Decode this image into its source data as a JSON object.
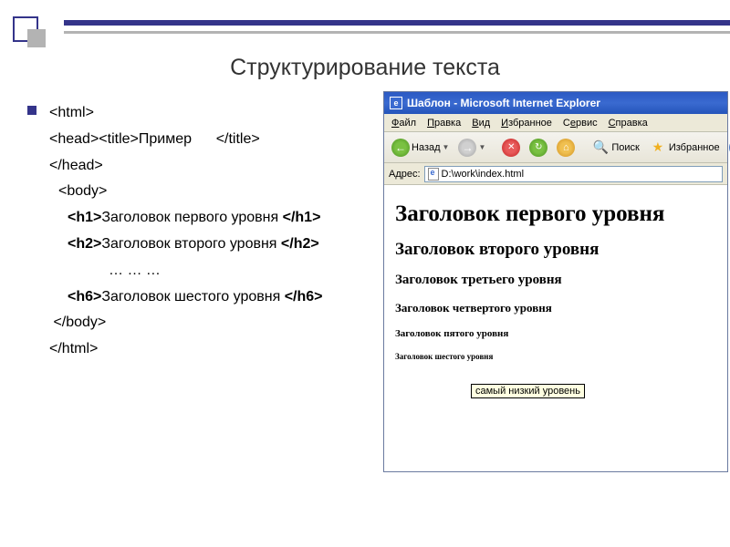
{
  "slide_title": "Структурирование текста",
  "code": {
    "l1": "<html>",
    "l2a": "<head><title>",
    "l2b": "Пример",
    "l2c": "      </title>",
    "l3": "</head>",
    "l4": "<body>",
    "l5a": "<h1>",
    "l5b": "Заголовок первого уровня ",
    "l5c": "</h1>",
    "l6a": "<h2>",
    "l6b": "Заголовок второго уровня ",
    "l6c": "</h2>",
    "l7": "… … …",
    "l8a": "<h6>",
    "l8b": "Заголовок шестого уровня ",
    "l8c": "</h6>",
    "l9": " </body>",
    "l10": "</html>"
  },
  "ie": {
    "title": "Шаблон - Microsoft Internet Explorer",
    "menu": {
      "file": "Файл",
      "edit": "Правка",
      "view": "Вид",
      "favorites": "Избранное",
      "tools": "Сервис",
      "help": "Справка"
    },
    "toolbar": {
      "back": "Назад",
      "search": "Поиск",
      "favorites": "Избранное"
    },
    "address_label": "Адрес:",
    "address_value": "D:\\work\\index.html",
    "headings": {
      "h1": "Заголовок первого уровня",
      "h2": "Заголовок второго уровня",
      "h3": "Заголовок третьего уровня",
      "h4": "Заголовок четвертого уровня",
      "h5": "Заголовок пятого уровня",
      "h6": "Заголовок шестого уровня"
    },
    "tooltip": "самый низкий уровень"
  }
}
